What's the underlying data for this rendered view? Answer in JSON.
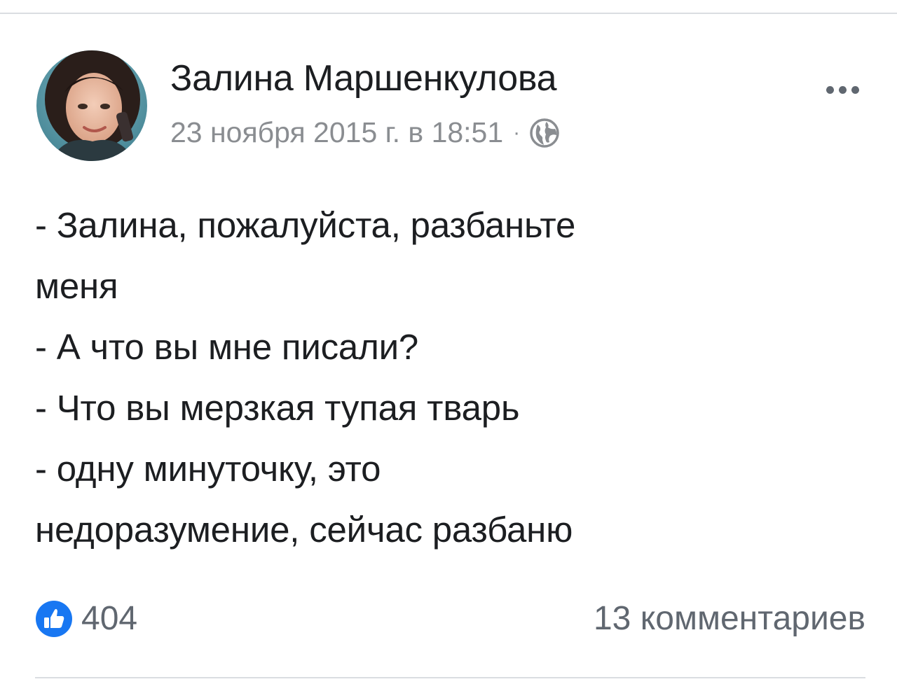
{
  "post": {
    "author": "Залина Маршенкулова",
    "date": "23 ноября 2015 г. в 18:51",
    "separator": "·",
    "privacy_icon": "globe-icon",
    "more_icon": "more-dots-icon",
    "body_lines": [
      "- Залина, пожалуйста, разбаньте",
      "меня",
      "- А что вы мне писали?",
      "- Что вы мерзкая тупая тварь",
      "- одну минуточку, это",
      "недоразумение, сейчас разбаню"
    ],
    "reactions": {
      "icon": "like-thumb-icon",
      "count": "404"
    },
    "comments": "13 комментариев"
  },
  "colors": {
    "text_primary": "#1c1e21",
    "text_secondary": "#8a8d91",
    "like_blue": "#1877f2",
    "divider": "#dadde1"
  }
}
